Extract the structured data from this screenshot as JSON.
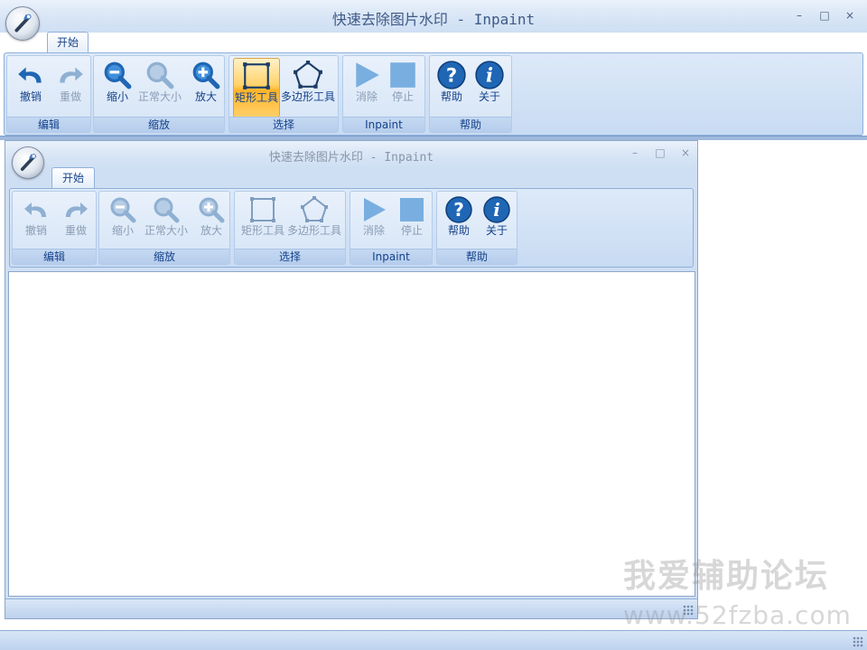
{
  "outer": {
    "title": "快速去除图片水印 - Inpaint",
    "tab": "开始",
    "window_buttons": [
      "–",
      "□",
      "×"
    ],
    "groups": [
      {
        "label": "编辑",
        "buttons": [
          {
            "label": "撤销",
            "icon": "undo-icon",
            "enabled": true
          },
          {
            "label": "重做",
            "icon": "redo-icon",
            "enabled": false
          }
        ]
      },
      {
        "label": "缩放",
        "buttons": [
          {
            "label": "缩小",
            "icon": "zoom-out-icon",
            "enabled": true
          },
          {
            "label": "正常大小",
            "icon": "zoom-normal-icon",
            "enabled": false
          },
          {
            "label": "放大",
            "icon": "zoom-in-icon",
            "enabled": true
          }
        ]
      },
      {
        "label": "选择",
        "buttons": [
          {
            "label": "矩形工具",
            "icon": "rectangle-tool-icon",
            "enabled": true,
            "active": true
          },
          {
            "label": "多边形工具",
            "icon": "polygon-tool-icon",
            "enabled": true
          }
        ]
      },
      {
        "label": "Inpaint",
        "buttons": [
          {
            "label": "消除",
            "icon": "play-icon",
            "enabled": false
          },
          {
            "label": "停止",
            "icon": "stop-icon",
            "enabled": false
          }
        ]
      },
      {
        "label": "帮助",
        "buttons": [
          {
            "label": "帮助",
            "icon": "help-icon",
            "enabled": true
          },
          {
            "label": "关于",
            "icon": "about-icon",
            "enabled": true
          }
        ]
      }
    ]
  },
  "inner": {
    "title": "快速去除图片水印 - Inpaint",
    "tab": "开始",
    "window_buttons": [
      "–",
      "□",
      "×"
    ],
    "groups": [
      {
        "label": "编辑",
        "buttons": [
          {
            "label": "撤销",
            "icon": "undo-icon",
            "enabled": false
          },
          {
            "label": "重做",
            "icon": "redo-icon",
            "enabled": false
          }
        ]
      },
      {
        "label": "缩放",
        "buttons": [
          {
            "label": "缩小",
            "icon": "zoom-out-icon",
            "enabled": false
          },
          {
            "label": "正常大小",
            "icon": "zoom-normal-icon",
            "enabled": false
          },
          {
            "label": "放大",
            "icon": "zoom-in-icon",
            "enabled": false
          }
        ]
      },
      {
        "label": "选择",
        "buttons": [
          {
            "label": "矩形工具",
            "icon": "rectangle-tool-icon",
            "enabled": false
          },
          {
            "label": "多边形工具",
            "icon": "polygon-tool-icon",
            "enabled": false
          }
        ]
      },
      {
        "label": "Inpaint",
        "buttons": [
          {
            "label": "消除",
            "icon": "play-icon",
            "enabled": false
          },
          {
            "label": "停止",
            "icon": "stop-icon",
            "enabled": false
          }
        ]
      },
      {
        "label": "帮助",
        "buttons": [
          {
            "label": "帮助",
            "icon": "help-icon",
            "enabled": true
          },
          {
            "label": "关于",
            "icon": "about-icon",
            "enabled": true
          }
        ]
      }
    ]
  },
  "watermark": {
    "line1": "我爱辅助论坛",
    "line2": "www.52fzba.com"
  },
  "colors": {
    "accent": "#1f66b4",
    "disabled": "#8fb0d2",
    "ribbon": "#d5e4f6",
    "active": "#ffc857"
  }
}
